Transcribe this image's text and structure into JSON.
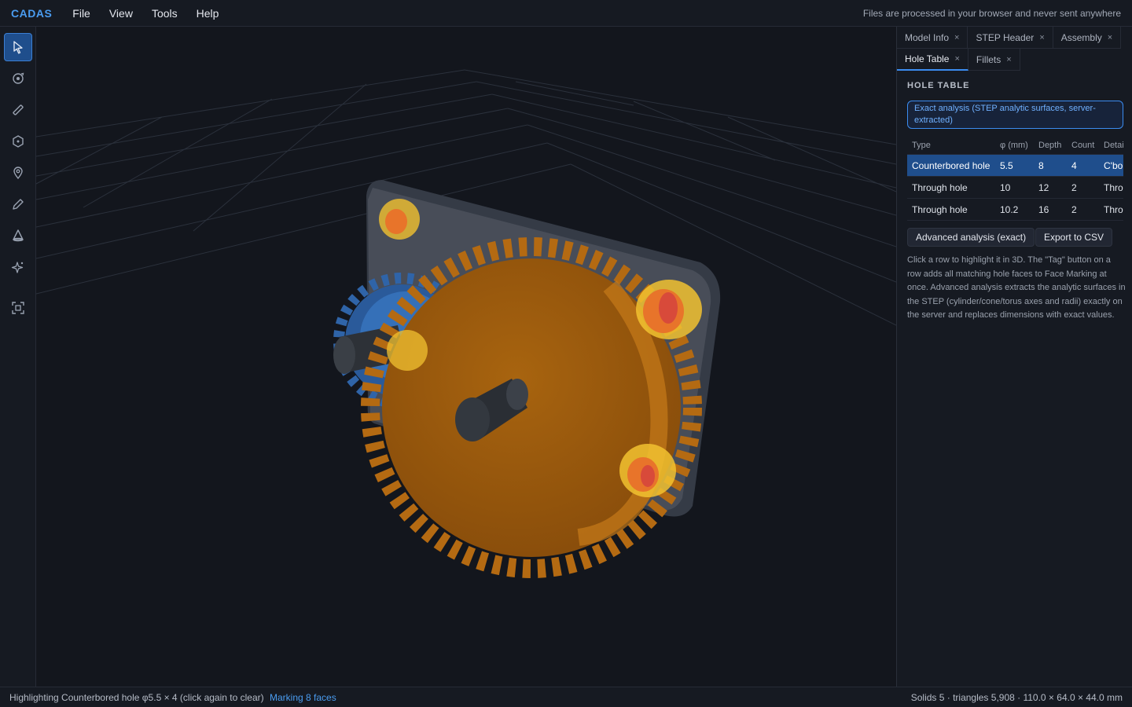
{
  "app": {
    "logo": "CADAS",
    "privacy_note": "Files are processed in your browser and never sent anywhere"
  },
  "menu": [
    "File",
    "View",
    "Tools",
    "Help"
  ],
  "toolbar": {
    "tools": [
      "select-icon",
      "orbit-icon",
      "measure-icon",
      "section-icon",
      "pin-icon",
      "pencil-icon",
      "cone-icon",
      "sparkle-icon",
      "fit-view-icon"
    ],
    "active": "select-icon"
  },
  "panel": {
    "tabs_row1": [
      {
        "label": "Model Info",
        "close": "×"
      },
      {
        "label": "STEP Header",
        "close": "×"
      },
      {
        "label": "Assembly",
        "close": "×"
      }
    ],
    "tabs_row2": [
      {
        "label": "Hole Table",
        "close": "×"
      },
      {
        "label": "Fillets",
        "close": "×"
      }
    ],
    "active_tab": "Hole Table",
    "section_title": "HOLE TABLE",
    "exact_note": "Exact analysis (STEP analytic surfaces, server-extracted)",
    "table": {
      "headers": [
        "Type",
        "φ (mm)",
        "Depth",
        "Count",
        "Detai"
      ],
      "rows": [
        {
          "type": "Counterbored hole",
          "dia": "5.5",
          "depth": "8",
          "count": "4",
          "detail": "C'bo"
        },
        {
          "type": "Through hole",
          "dia": "10",
          "depth": "12",
          "count": "2",
          "detail": "Thro"
        },
        {
          "type": "Through hole",
          "dia": "10.2",
          "depth": "16",
          "count": "2",
          "detail": "Thro"
        }
      ]
    },
    "buttons": {
      "advanced": "Advanced analysis (exact)",
      "export": "Export to CSV"
    },
    "help_text": "Click a row to highlight it in 3D. The \"Tag\" button on a row adds all matching hole faces to Face Marking at once. Advanced analysis extracts the analytic surfaces in the STEP (cylinder/cone/torus axes and radii) exactly on the server and replaces dimensions with exact values."
  },
  "status": {
    "left": "Highlighting Counterbored hole φ5.5 × 4 (click again to clear)",
    "marking": "Marking 8 faces",
    "right": "Solids 5 · triangles 5,908 · 110.0 × 64.0 × 44.0 mm"
  },
  "colors": {
    "accent": "#3b8cf0",
    "gear_large": "#b46a12",
    "gear_small": "#2f64a8",
    "highlight": "#f2c230",
    "plate": "#4b515c"
  }
}
